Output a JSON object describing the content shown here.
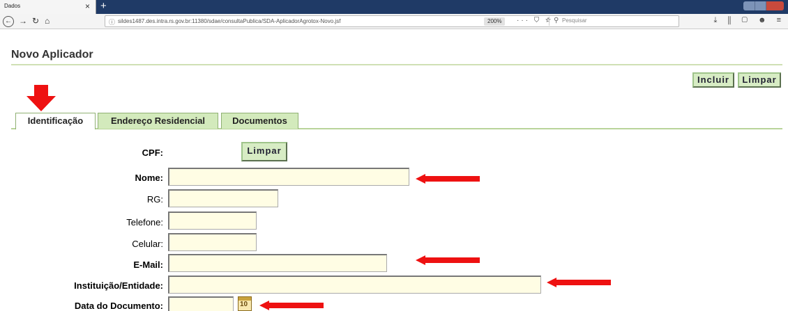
{
  "browser": {
    "tab_title": "Dados",
    "tab_close": "×",
    "new_tab": "+",
    "url": "sildes1487.des.intra.rs.gov.br:11380/sdae/consultaPublica/SDA-AplicadorAgrotox-Novo.jsf",
    "zoom": "200%",
    "page_actions": "··· ⛉ ☆",
    "search_placeholder": "Pesquisar",
    "toolbar_icons": "⤓ ⫼ ▢ ☻ ≡"
  },
  "page": {
    "title": "Novo Aplicador",
    "incluir_label": "Incluir",
    "limpar_label": "Limpar"
  },
  "tabs": [
    {
      "label": "Identificação",
      "active": true
    },
    {
      "label": "Endereço Residencial",
      "active": false
    },
    {
      "label": "Documentos",
      "active": false
    }
  ],
  "form": {
    "cpf_label": "CPF:",
    "cpf_limpar_label": "Limpar",
    "nome_label": "Nome:",
    "rg_label": "RG:",
    "telefone_label": "Telefone:",
    "celular_label": "Celular:",
    "email_label": "E-Mail:",
    "instituicao_label": "Instituição/Entidade:",
    "data_documento_label": "Data do Documento:",
    "nome_value": "",
    "rg_value": "",
    "telefone_value": "",
    "celular_value": "",
    "email_value": "",
    "instituicao_value": "",
    "data_documento_value": "",
    "calendar_day": "10"
  },
  "colors": {
    "tab_inactive": "#d3eabc",
    "button_green": "#d7ecc4",
    "input_bg": "#fffde4",
    "annotation_red": "#ee1111"
  }
}
